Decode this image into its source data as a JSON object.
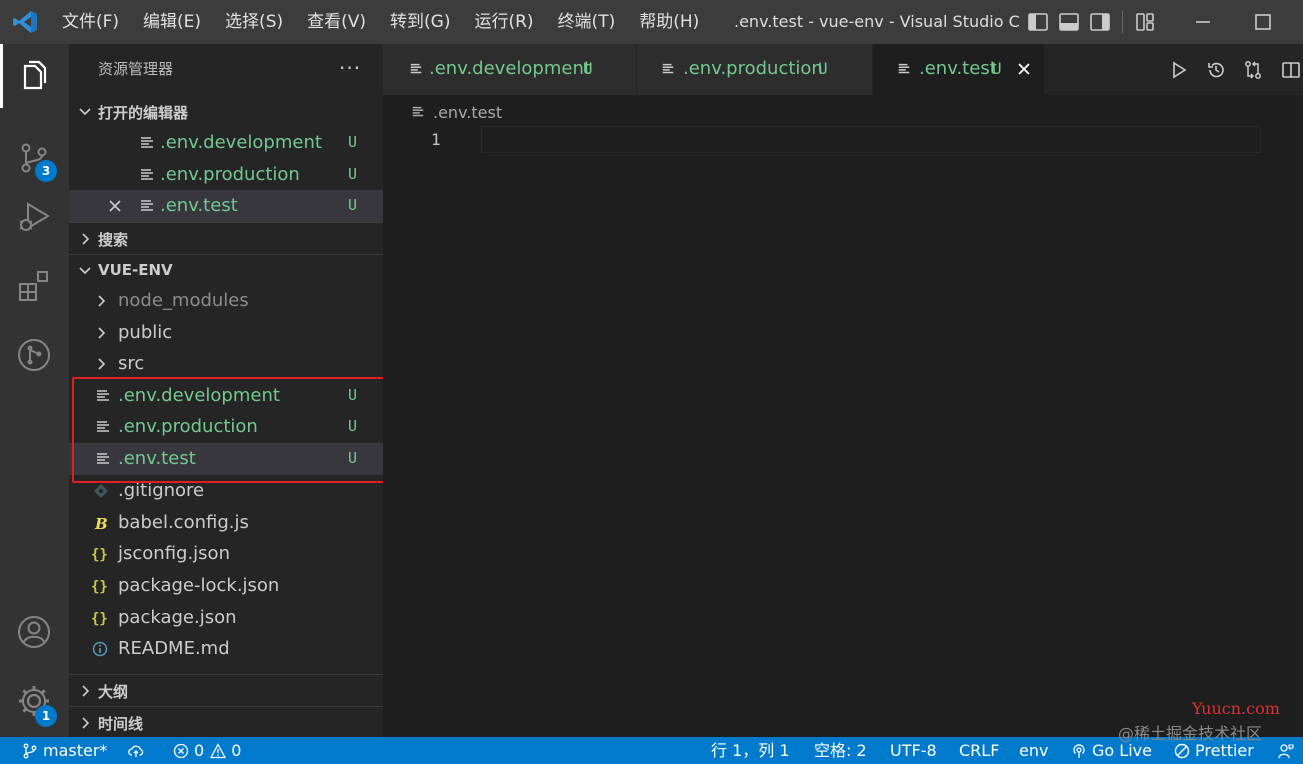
{
  "titlebar": {
    "menus": [
      "文件(F)",
      "编辑(E)",
      "选择(S)",
      "查看(V)",
      "转到(G)",
      "运行(R)",
      "终端(T)",
      "帮助(H)"
    ],
    "window_title": ".env.test - vue-env - Visual Studio C..."
  },
  "activitybar": {
    "items": [
      "explorer-icon",
      "source-control-icon",
      "run-debug-icon",
      "extensions-icon",
      "git-graph-icon",
      "accounts-icon",
      "manage-gear-icon"
    ],
    "source_control_badge": "3",
    "manage_badge": "1"
  },
  "sidebar": {
    "title": "资源管理器",
    "more": "···",
    "open_editors": {
      "label": "打开的编辑器",
      "files": [
        {
          "name": ".env.development",
          "badge": "U"
        },
        {
          "name": ".env.production",
          "badge": "U"
        },
        {
          "name": ".env.test",
          "badge": "U"
        }
      ]
    },
    "search": {
      "label": "搜索"
    },
    "workspace": {
      "label": "VUE-ENV",
      "folders": [
        "node_modules",
        "public",
        "src"
      ],
      "env_files": [
        {
          "name": ".env.development",
          "badge": "U"
        },
        {
          "name": ".env.production",
          "badge": "U"
        },
        {
          "name": ".env.test",
          "badge": "U"
        }
      ],
      "files": [
        {
          "name": ".gitignore",
          "icon": "git-icon"
        },
        {
          "name": "babel.config.js",
          "icon": "babel-icon"
        },
        {
          "name": "jsconfig.json",
          "icon": "json-braces-icon"
        },
        {
          "name": "package-lock.json",
          "icon": "json-braces-icon"
        },
        {
          "name": "package.json",
          "icon": "json-braces-icon"
        },
        {
          "name": "README.md",
          "icon": "info-icon"
        }
      ]
    },
    "outline": {
      "label": "大纲"
    },
    "timeline": {
      "label": "时间线"
    }
  },
  "tabs": [
    {
      "name": ".env.development",
      "badge": "U"
    },
    {
      "name": ".env.production",
      "badge": "U"
    },
    {
      "name": ".env.test",
      "badge": "U"
    }
  ],
  "editor": {
    "breadcrumb": ".env.test",
    "line_number": "1"
  },
  "statusbar": {
    "branch": "master*",
    "errors": "0",
    "warnings": "0",
    "cursor": "行 1，列 1",
    "spaces": "空格: 2",
    "encoding": "UTF-8",
    "eol": "CRLF",
    "language": "env",
    "golive": "Go Live",
    "prettier": "Prettier"
  },
  "watermark": {
    "site": "Yuucn.com",
    "credit": "@稀土掘金技术社区"
  },
  "colors": {
    "untracked_green": "#73c991",
    "status_blue": "#007acc",
    "highlight_red": "#e02020"
  }
}
